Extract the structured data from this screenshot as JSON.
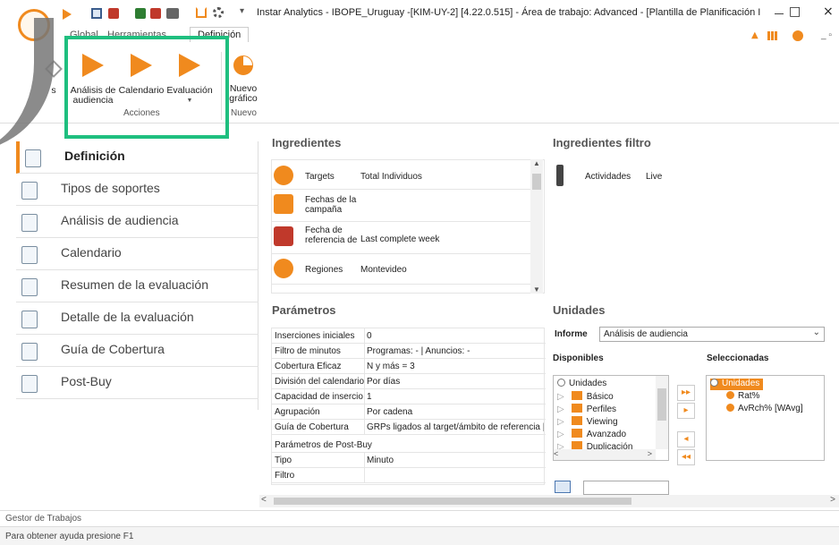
{
  "window": {
    "title": "Instar Analytics - IBOPE_Uruguay -[KIM-UY-2]  [4.22.0.515] - Área de trabajo: Advanced - [Plantilla de Planificación I",
    "minimize": "□",
    "close": "×"
  },
  "ribbon": {
    "tabs": [
      "Global",
      "Herramientas",
      "Definición"
    ],
    "buttons": {
      "analisis": "Análisis de audiencia",
      "calendario": "Calendario",
      "evaluacion": "Evaluación",
      "nuevo_grafico": "Nuevo gráfico",
      "left_partial": "s"
    },
    "groups": {
      "acciones": "Acciones",
      "nuevo": "Nuevo"
    }
  },
  "nav": {
    "items": [
      {
        "label": "Definición",
        "active": true
      },
      {
        "label": "Tipos de soportes"
      },
      {
        "label": "Análisis de audiencia"
      },
      {
        "label": "Calendario"
      },
      {
        "label": "Resumen de la evaluación"
      },
      {
        "label": "Detalle de la evaluación"
      },
      {
        "label": "Guía de Cobertura"
      },
      {
        "label": "Post-Buy"
      }
    ]
  },
  "ingredientes": {
    "title": "Ingredientes",
    "rows": [
      {
        "name": "Targets",
        "value": "Total Individuos",
        "icon": "people-icon"
      },
      {
        "name": "Fechas de la campaña",
        "value": "",
        "icon": "calendar-icon"
      },
      {
        "name": "Fecha de referencia de",
        "value": "Last complete week",
        "icon": "calendar-icon"
      },
      {
        "name": "Regiones",
        "value": "Montevideo",
        "icon": "globe-icon"
      }
    ]
  },
  "ingredientes_filtro": {
    "title": "Ingredientes filtro",
    "rows": [
      {
        "name": "Actividades",
        "value": "Live",
        "icon": "remote-icon"
      }
    ]
  },
  "parametros": {
    "title": "Parámetros",
    "rows": [
      {
        "k": "Inserciones iniciales",
        "v": "0"
      },
      {
        "k": "Filtro de minutos",
        "v": "Programas: - | Anuncios: -"
      },
      {
        "k": "Cobertura Eficaz",
        "v": "N y más = 3"
      },
      {
        "k": "División del calendario",
        "v": "Por días"
      },
      {
        "k": "Capacidad de insercio",
        "v": "1"
      },
      {
        "k": "Agrupación",
        "v": "Por cadena"
      },
      {
        "k": "Guía de Cobertura",
        "v": "GRPs ligados al target/ámbito de referencia |"
      },
      {
        "k": "Parámetros de Post-Buy",
        "v": ""
      },
      {
        "k": "Tipo",
        "v": "Minuto"
      },
      {
        "k": "Filtro",
        "v": ""
      }
    ]
  },
  "unidades": {
    "title": "Unidades",
    "informe_label": "Informe",
    "informe_value": "Análisis de audiencia",
    "disponibles_label": "Disponibles",
    "seleccionadas_label": "Seleccionadas",
    "disponibles": [
      "Unidades",
      "Básico",
      "Perfiles",
      "Viewing",
      "Avanzado",
      "Duplicación"
    ],
    "seleccionadas": [
      "Unidades",
      "Rat%",
      "AvRch% [WAvg]"
    ]
  },
  "status": {
    "gestor": "Gestor de Trabajos",
    "help": "Para obtener ayuda presione F1"
  },
  "colors": {
    "accent": "#f08a1e",
    "highlight": "#1fbf7f"
  }
}
